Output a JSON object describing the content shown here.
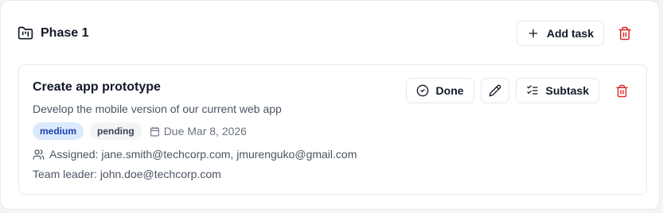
{
  "phase": {
    "icon": "kanban-folder-icon",
    "title": "Phase 1",
    "add_task_label": "Add task",
    "colors": {
      "danger": "#dc2626",
      "border": "#e5e7eb"
    }
  },
  "task": {
    "title": "Create app prototype",
    "description": "Develop the mobile version of our current web app",
    "priority": "medium",
    "status": "pending",
    "due": "Due Mar 8, 2026",
    "assigned": "Assigned: jane.smith@techcorp.com, jmurenguko@gmail.com",
    "team_leader": "Team leader: john.doe@techcorp.com",
    "actions": {
      "done_label": "Done",
      "subtask_label": "Subtask"
    },
    "colors": {
      "priority_bg": "#dbeafe",
      "priority_text": "#1e40af",
      "status_bg": "#f3f4f6"
    }
  }
}
